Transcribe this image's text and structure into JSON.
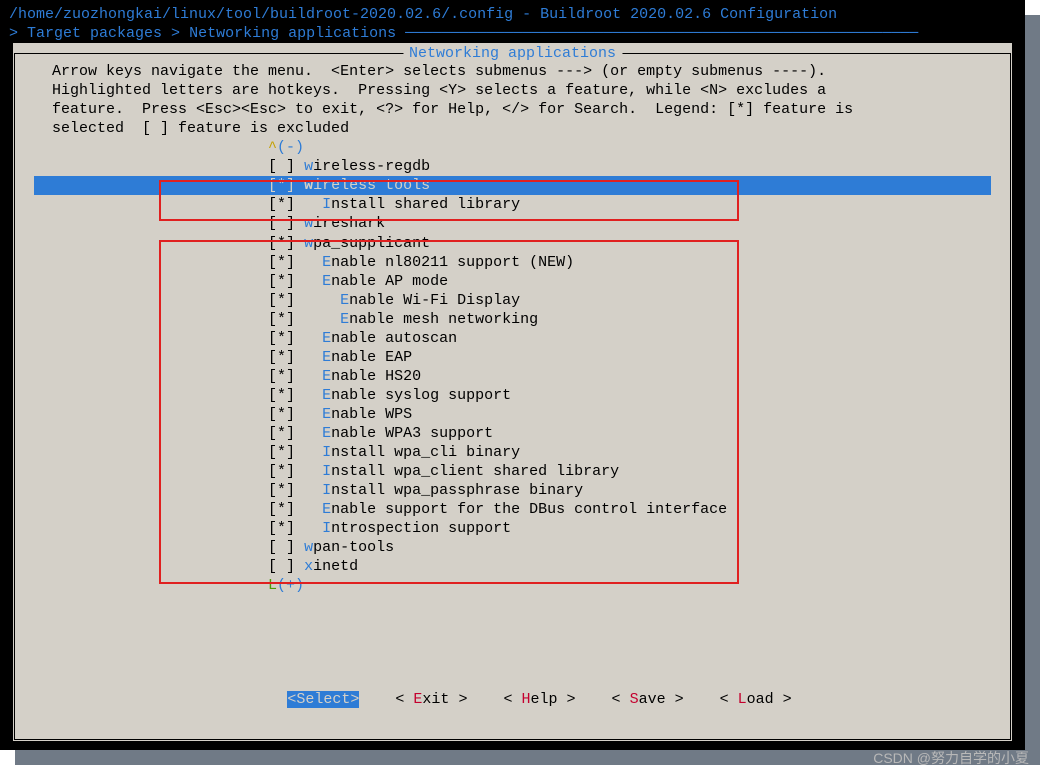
{
  "title": "/home/zuozhongkai/linux/tool/buildroot-2020.02.6/.config - Buildroot 2020.02.6 Configuration",
  "breadcrumb": {
    "prefix": "> ",
    "path1": "Target packages",
    "sep": " > ",
    "path2": "Networking applications"
  },
  "panel_title": " Networking applications ",
  "help": "  Arrow keys navigate the menu.  <Enter> selects submenus ---> (or empty submenus ----).\n  Highlighted letters are hotkeys.  Pressing <Y> selects a feature, while <N> excludes a\n  feature.  Press <Esc><Esc> to exit, <?> for Help, </> for Search.  Legend: [*] feature is\n  selected  [ ] feature is excluded",
  "scroll_top": {
    "caret": "                          ^",
    "minus": "(-)"
  },
  "scroll_bot": {
    "l": "                          L",
    "plus": "(+)"
  },
  "items": [
    {
      "indent": "                          ",
      "mark": "[ ]",
      "pre": " ",
      "hot": "w",
      "rest": "ireless-regdb",
      "selected": false
    },
    {
      "indent": "                          ",
      "mark": "[*]",
      "pre": " ",
      "hot": "w",
      "rest": "ireless tools",
      "selected": true
    },
    {
      "indent": "                          ",
      "mark": "[*]",
      "pre": "   ",
      "hot": "I",
      "rest": "nstall shared library",
      "selected": false
    },
    {
      "indent": "                          ",
      "mark": "[ ]",
      "pre": " ",
      "hot": "w",
      "rest": "ireshark",
      "selected": false
    },
    {
      "indent": "                          ",
      "mark": "[*]",
      "pre": " ",
      "hot": "w",
      "rest": "pa_supplicant",
      "selected": false
    },
    {
      "indent": "                          ",
      "mark": "[*]",
      "pre": "   ",
      "hot": "E",
      "rest": "nable nl80211 support (NEW)",
      "selected": false
    },
    {
      "indent": "                          ",
      "mark": "[*]",
      "pre": "   ",
      "hot": "E",
      "rest": "nable AP mode",
      "selected": false
    },
    {
      "indent": "                          ",
      "mark": "[*]",
      "pre": "     ",
      "hot": "E",
      "rest": "nable Wi-Fi Display",
      "selected": false
    },
    {
      "indent": "                          ",
      "mark": "[*]",
      "pre": "     ",
      "hot": "E",
      "rest": "nable mesh networking",
      "selected": false
    },
    {
      "indent": "                          ",
      "mark": "[*]",
      "pre": "   ",
      "hot": "E",
      "rest": "nable autoscan",
      "selected": false
    },
    {
      "indent": "                          ",
      "mark": "[*]",
      "pre": "   ",
      "hot": "E",
      "rest": "nable EAP",
      "selected": false
    },
    {
      "indent": "                          ",
      "mark": "[*]",
      "pre": "   ",
      "hot": "E",
      "rest": "nable HS20",
      "selected": false
    },
    {
      "indent": "                          ",
      "mark": "[*]",
      "pre": "   ",
      "hot": "E",
      "rest": "nable syslog support",
      "selected": false
    },
    {
      "indent": "                          ",
      "mark": "[*]",
      "pre": "   ",
      "hot": "E",
      "rest": "nable WPS",
      "selected": false
    },
    {
      "indent": "                          ",
      "mark": "[*]",
      "pre": "   ",
      "hot": "E",
      "rest": "nable WPA3 support",
      "selected": false
    },
    {
      "indent": "                          ",
      "mark": "[*]",
      "pre": "   ",
      "hot": "I",
      "rest": "nstall wpa_cli binary",
      "selected": false
    },
    {
      "indent": "                          ",
      "mark": "[*]",
      "pre": "   ",
      "hot": "I",
      "rest": "nstall wpa_client shared library",
      "selected": false
    },
    {
      "indent": "                          ",
      "mark": "[*]",
      "pre": "   ",
      "hot": "I",
      "rest": "nstall wpa_passphrase binary",
      "selected": false
    },
    {
      "indent": "                          ",
      "mark": "[*]",
      "pre": "   ",
      "hot": "E",
      "rest": "nable support for the DBus control interface",
      "selected": false
    },
    {
      "indent": "                          ",
      "mark": "[*]",
      "pre": "   ",
      "hot": "I",
      "rest": "ntrospection support",
      "selected": false
    },
    {
      "indent": "                          ",
      "mark": "[ ]",
      "pre": " ",
      "hot": "w",
      "rest": "pan-tools",
      "selected": false
    },
    {
      "indent": "                          ",
      "mark": "[ ]",
      "pre": " ",
      "hot": "x",
      "rest": "inetd",
      "selected": false
    }
  ],
  "buttons": {
    "select": {
      "open": "<",
      "hot": "S",
      "rest": "elect",
      "close": ">"
    },
    "exit": {
      "open": "< ",
      "hot": "E",
      "rest": "xit ",
      "close": ">"
    },
    "help": {
      "open": "< ",
      "hot": "H",
      "rest": "elp ",
      "close": ">"
    },
    "save": {
      "open": "< ",
      "hot": "S",
      "rest": "ave ",
      "close": ">"
    },
    "load": {
      "open": "< ",
      "hot": "L",
      "rest": "oad ",
      "close": ">"
    },
    "gap": "    "
  },
  "watermark": "CSDN @努力自学的小夏"
}
